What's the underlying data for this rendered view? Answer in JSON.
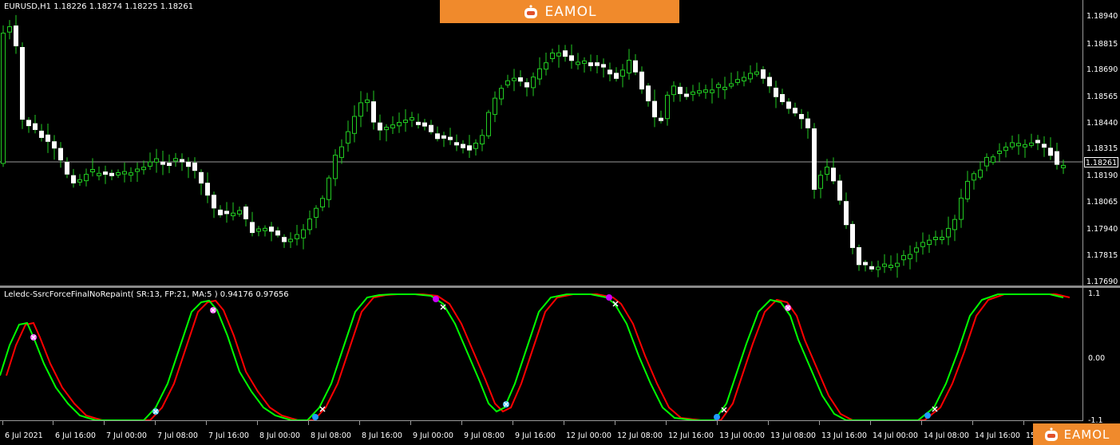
{
  "chart": {
    "symbol_header": "EURUSD,H1  1.18226 1.18274 1.18225 1.18261",
    "current_price": "1.18261",
    "price_labels": [
      "1.18940",
      "1.18815",
      "1.18690",
      "1.18565",
      "1.18440",
      "1.18315",
      "1.18190",
      "1.18065",
      "1.17940",
      "1.17815",
      "1.17690"
    ],
    "bull_color": "#22cc22",
    "bear_color": "#ffffff"
  },
  "indicator": {
    "header": "Leledc-SsrcForceFinalNoRepaint( SR:13, FP:21, MA:5 ) 0.94176 0.97656",
    "labels": [
      "1.1",
      "0.00",
      "-1.1"
    ],
    "fast_color": "#00ff00",
    "slow_color": "#ff0000"
  },
  "time_axis": [
    "6 Jul 2021",
    "6 Jul 16:00",
    "7 Jul 00:00",
    "7 Jul 08:00",
    "7 Jul 16:00",
    "8 Jul 00:00",
    "8 Jul 08:00",
    "8 Jul 16:00",
    "9 Jul 00:00",
    "9 Jul 08:00",
    "9 Jul 16:00",
    "12 Jul 00:00",
    "12 Jul 08:00",
    "12 Jul 16:00",
    "13 Jul 00:00",
    "13 Jul 08:00",
    "13 Jul 16:00",
    "14 Jul 00:00",
    "14 Jul 08:00",
    "14 Jul 16:00",
    "15"
  ],
  "branding": {
    "banner_text": "EAMOL",
    "corner_text": "EAMOL",
    "accent": "#f08a2c"
  }
}
